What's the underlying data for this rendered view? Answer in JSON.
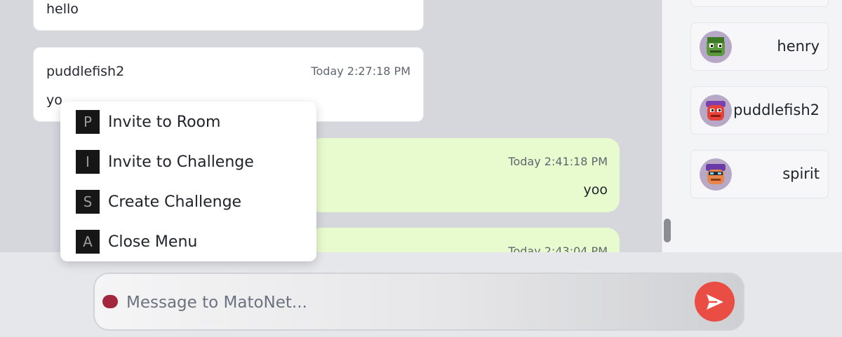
{
  "messages": [
    {
      "author": "",
      "time": "",
      "text": "hello"
    },
    {
      "author": "puddlefish2",
      "time": "Today 2:27:18 PM",
      "text": "yo"
    }
  ],
  "own_messages": [
    {
      "time": "Today 2:41:18 PM",
      "text": "yoo"
    },
    {
      "time": "Today 2:43:04 PM",
      "text": ""
    }
  ],
  "users": [
    {
      "name": "henry"
    },
    {
      "name": "puddlefish2"
    },
    {
      "name": "spirit"
    }
  ],
  "context_menu": {
    "items": [
      {
        "key": "P",
        "label": "Invite to Room"
      },
      {
        "key": "I",
        "label": "Invite to Challenge"
      },
      {
        "key": "S",
        "label": "Create Challenge"
      },
      {
        "key": "A",
        "label": "Close Menu"
      }
    ]
  },
  "composer": {
    "placeholder": "Message to MatoNet...",
    "value": ""
  },
  "colors": {
    "own_bubble": "#e8fbcf",
    "send_button": "#e94d43",
    "record_dot": "#a3283d"
  },
  "icons": {
    "send": "send-arrow-icon",
    "record": "record-dot-icon"
  }
}
